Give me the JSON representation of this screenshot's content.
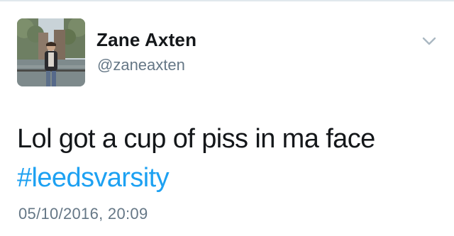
{
  "user": {
    "display_name": "Zane Axten",
    "handle": "@zaneaxten"
  },
  "tweet": {
    "text": "Lol got a cup of piss in ma face",
    "hashtag": "#leedsvarsity",
    "timestamp": "05/10/2016, 20:09"
  },
  "icons": {
    "menu": "chevron-down-icon",
    "avatar": "avatar"
  },
  "colors": {
    "name": "#14171a",
    "secondary": "#657786",
    "link": "#1da1f2",
    "divider": "#e1e8ed"
  }
}
